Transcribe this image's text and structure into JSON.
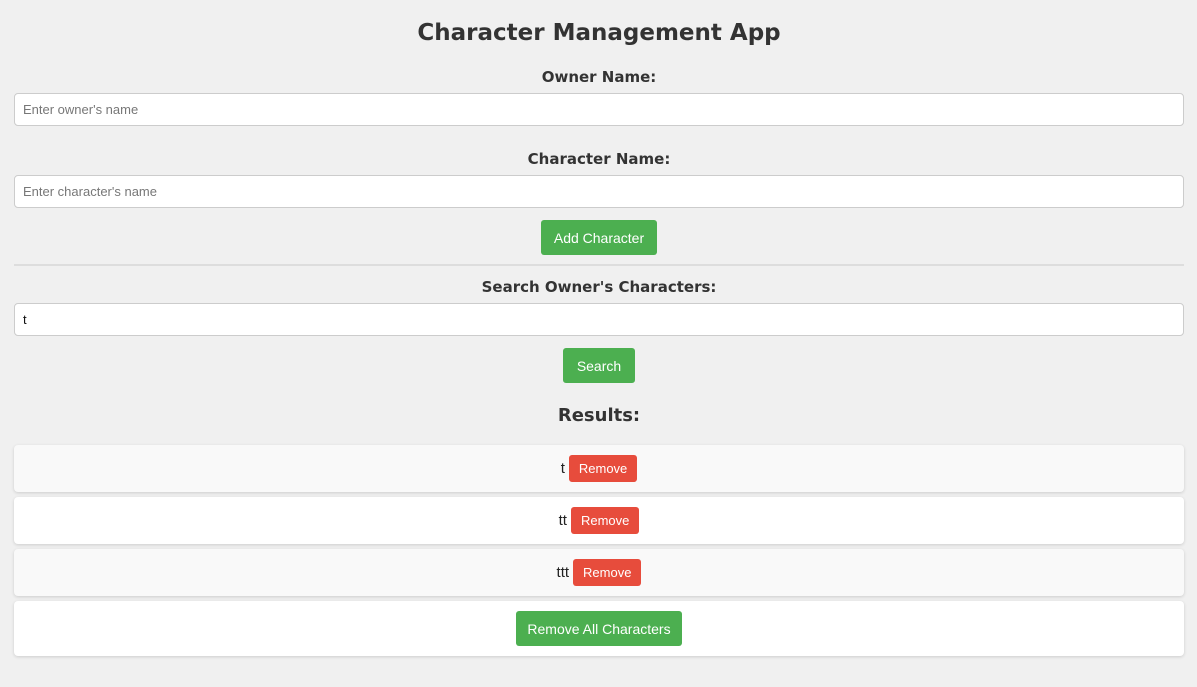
{
  "app": {
    "title": "Character Management App"
  },
  "owner": {
    "label": "Owner Name:",
    "placeholder": "Enter owner's name",
    "value": ""
  },
  "character": {
    "label": "Character Name:",
    "placeholder": "Enter character's name",
    "value": ""
  },
  "add_button": {
    "label": "Add Character"
  },
  "search": {
    "label": "Search Owner's Characters:",
    "value": "t",
    "button_label": "Search"
  },
  "results": {
    "title": "Results:",
    "items": [
      {
        "name": "t",
        "remove_label": "Remove"
      },
      {
        "name": "tt",
        "remove_label": "Remove"
      },
      {
        "name": "ttt",
        "remove_label": "Remove"
      }
    ],
    "remove_all_label": "Remove All Characters"
  },
  "colors": {
    "primary_green": "#4caf50",
    "danger_red": "#e74c3c",
    "background": "#f0f0f0"
  }
}
